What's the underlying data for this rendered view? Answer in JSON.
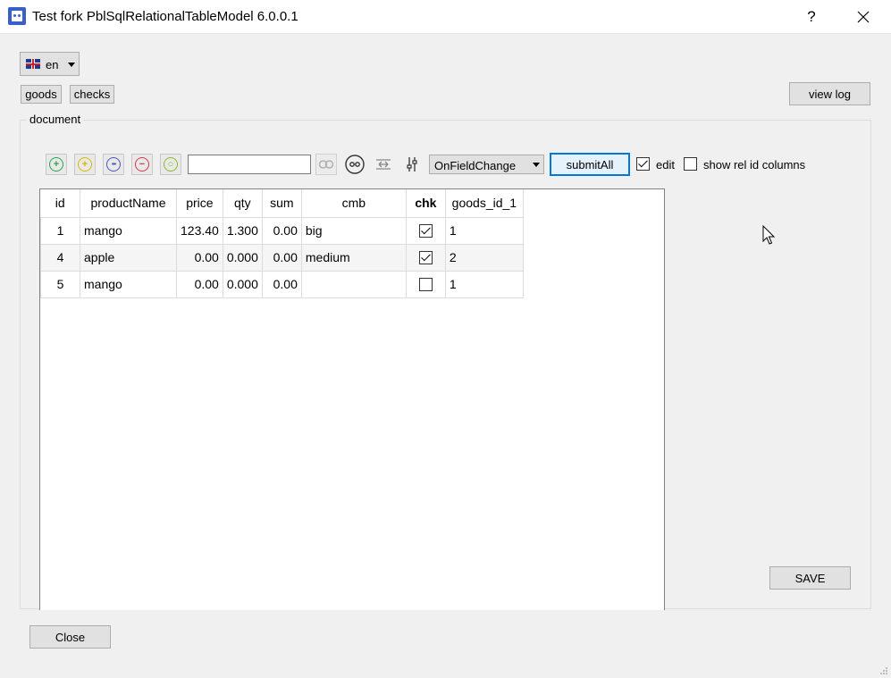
{
  "window": {
    "title": "Test fork PblSqlRelationalTableModel 6.0.0.1",
    "help_label": "?",
    "close_glyph": "✕"
  },
  "language": {
    "selected": "en",
    "flag_icon": "uk-flag-icon"
  },
  "nav": {
    "goods_label": "goods",
    "checks_label": "checks",
    "view_log_label": "view log"
  },
  "group": {
    "label": "document"
  },
  "toolbar": {
    "icons": [
      {
        "name": "insert-row-icon",
        "glyph": "+",
        "color": "#2aa44a"
      },
      {
        "name": "insert-copy-icon",
        "glyph": "+",
        "color": "#d6b800"
      },
      {
        "name": "more-options-icon",
        "glyph": "•••",
        "color": "#4a57b8"
      },
      {
        "name": "delete-row-icon",
        "glyph": "−",
        "color": "#d63a4a"
      },
      {
        "name": "refresh-icon",
        "glyph": "○",
        "color": "#8fb52a"
      }
    ],
    "filter_value": "",
    "edit_strategy": "OnFieldChange",
    "submit_label": "submitAll",
    "edit_label": "edit",
    "edit_checked": true,
    "show_rel_label": "show rel id columns",
    "show_rel_checked": false
  },
  "table": {
    "columns": [
      "id",
      "productName",
      "price",
      "qty",
      "sum",
      "cmb",
      "chk",
      "goods_id_1"
    ],
    "rows": [
      {
        "id": "1",
        "productName": "mango",
        "price": "123.40",
        "qty": "1.300",
        "sum": "0.00",
        "cmb": "big",
        "chk": true,
        "goods_id_1": "1"
      },
      {
        "id": "4",
        "productName": "apple",
        "price": "0.00",
        "qty": "0.000",
        "sum": "0.00",
        "cmb": "medium",
        "chk": true,
        "goods_id_1": "2"
      },
      {
        "id": "5",
        "productName": "mango",
        "price": "0.00",
        "qty": "0.000",
        "sum": "0.00",
        "cmb": "",
        "chk": false,
        "goods_id_1": "1"
      }
    ]
  },
  "actions": {
    "save_label": "SAVE",
    "close_label": "Close"
  }
}
